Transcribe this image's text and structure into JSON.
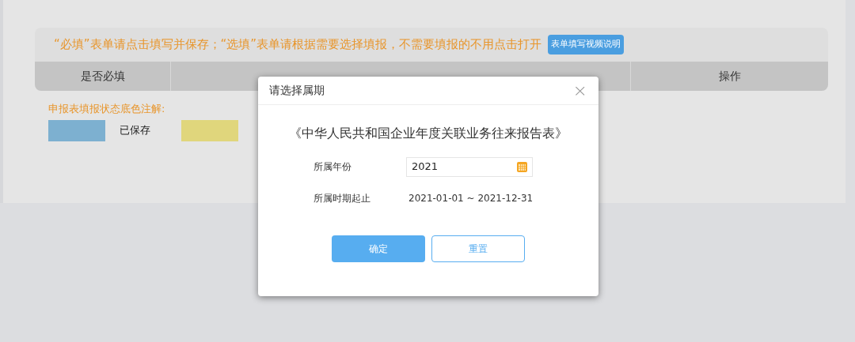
{
  "notice": {
    "text": "“必填”表单请点击填写并保存；“选填”表单请根据需要选择填报，不需要填报的不用点击打开",
    "video_button": "表单填写视频说明"
  },
  "table": {
    "columns": [
      {
        "kind": "label",
        "label": "是否必填"
      },
      {
        "kind": "covered"
      },
      {
        "kind": "label",
        "label": "操作"
      }
    ]
  },
  "legend": {
    "title": "申报表填报状态底色注解:",
    "items": [
      {
        "label": "已保存",
        "color": "#7db0d0"
      },
      {
        "color": "#e0d67c"
      }
    ]
  },
  "dialog": {
    "title": "请选择属期",
    "close": "×",
    "form_title": "《中华人民共和国企业年度关联业务往来报告表》",
    "fields": [
      {
        "kind": "input",
        "label": "所属年份",
        "value": "2021"
      },
      {
        "kind": "text",
        "label": "所属时期起止",
        "value": "2021-01-01 ~ 2021-12-31"
      }
    ],
    "buttons": [
      {
        "label": "确定",
        "kind": "primary"
      },
      {
        "label": "重置",
        "kind": "secondary"
      }
    ]
  }
}
